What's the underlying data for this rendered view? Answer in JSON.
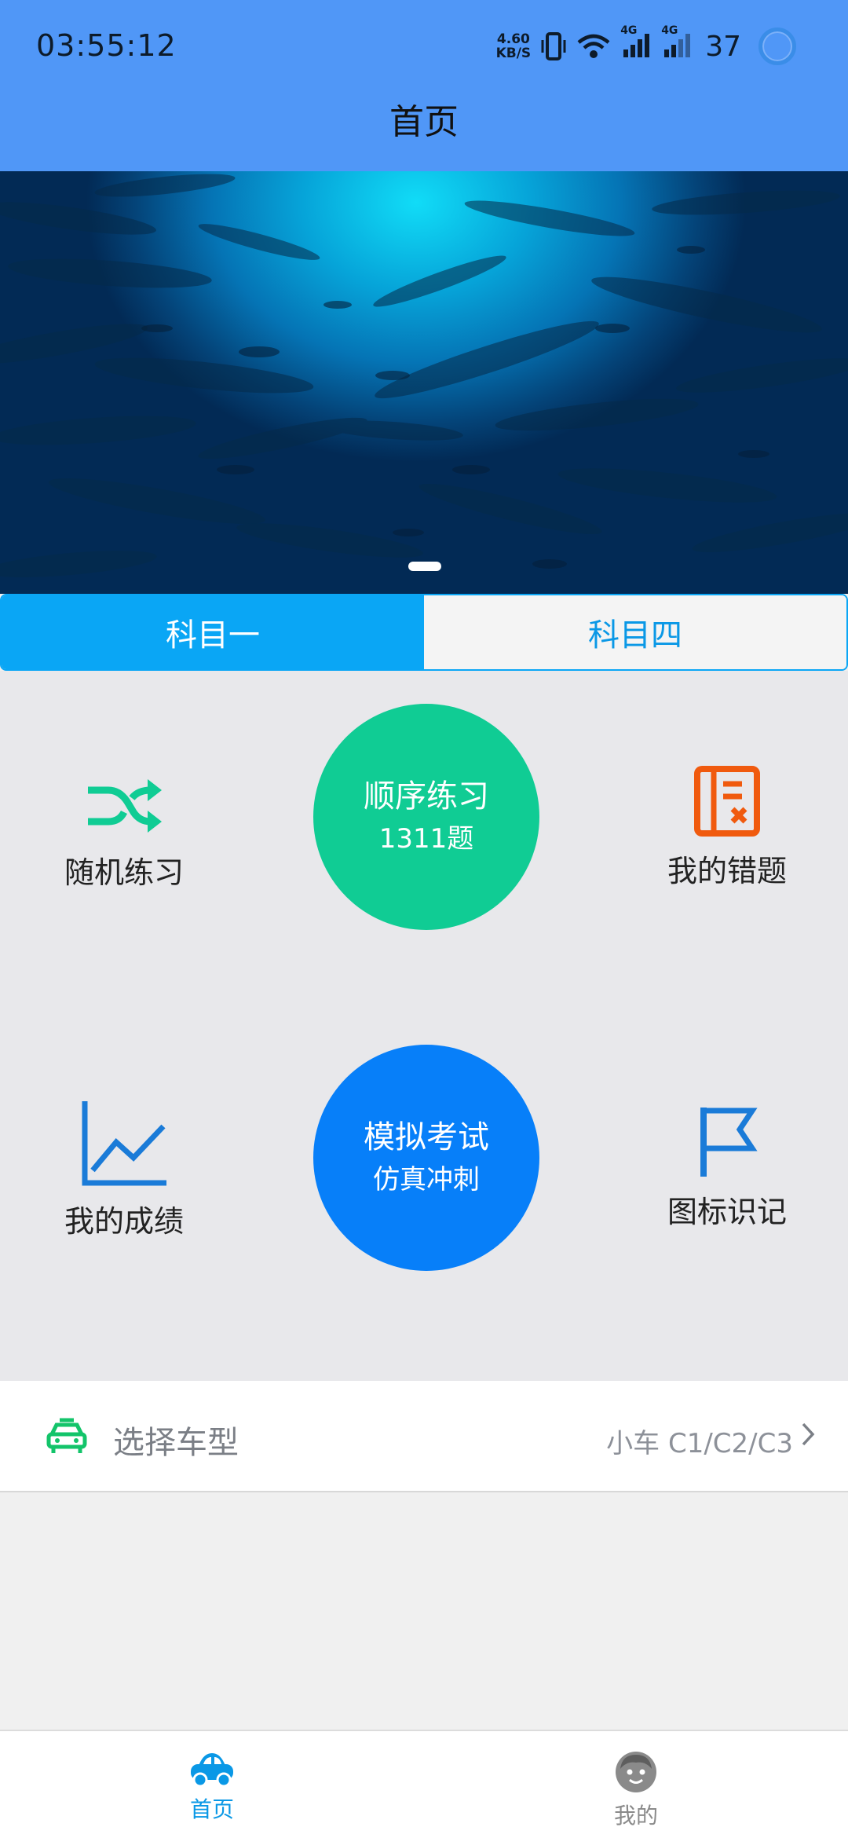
{
  "status_bar": {
    "time": "03:55:12",
    "net_speed_value": "4.60",
    "net_speed_unit": "KB/S",
    "signal_1_label": "4G",
    "signal_2_label": "4G",
    "battery": "37"
  },
  "header": {
    "title": "首页"
  },
  "subject_tabs": [
    {
      "label": "科目一",
      "active": true
    },
    {
      "label": "科目四",
      "active": false
    }
  ],
  "features": {
    "random_practice": "随机练习",
    "my_mistakes": "我的错题",
    "my_scores": "我的成绩",
    "sign_recognition": "图标识记"
  },
  "sequential_practice": {
    "title": "顺序练习",
    "count": "1311题",
    "color": "#10cc94"
  },
  "mock_exam": {
    "title": "模拟考试",
    "subtitle": "仿真冲刺",
    "color": "#077ff9"
  },
  "car_type": {
    "label": "选择车型",
    "value": "小车 C1/C2/C3"
  },
  "bottom_nav": [
    {
      "label": "首页",
      "active": true
    },
    {
      "label": "我的",
      "active": false
    }
  ],
  "colors": {
    "accent": "#0aa6f5",
    "header": "#5097f7",
    "mistakes_icon": "#f05a0e",
    "shuffle_icon": "#10cc94",
    "scores_icon": "#1a7bd8"
  },
  "icons": {
    "shuffle": "shuffle-icon",
    "mistakes": "mistake-book-icon",
    "scores": "line-chart-icon",
    "signs": "flag-icon",
    "car": "car-icon",
    "home": "car-home-icon",
    "profile": "avatar-icon"
  }
}
